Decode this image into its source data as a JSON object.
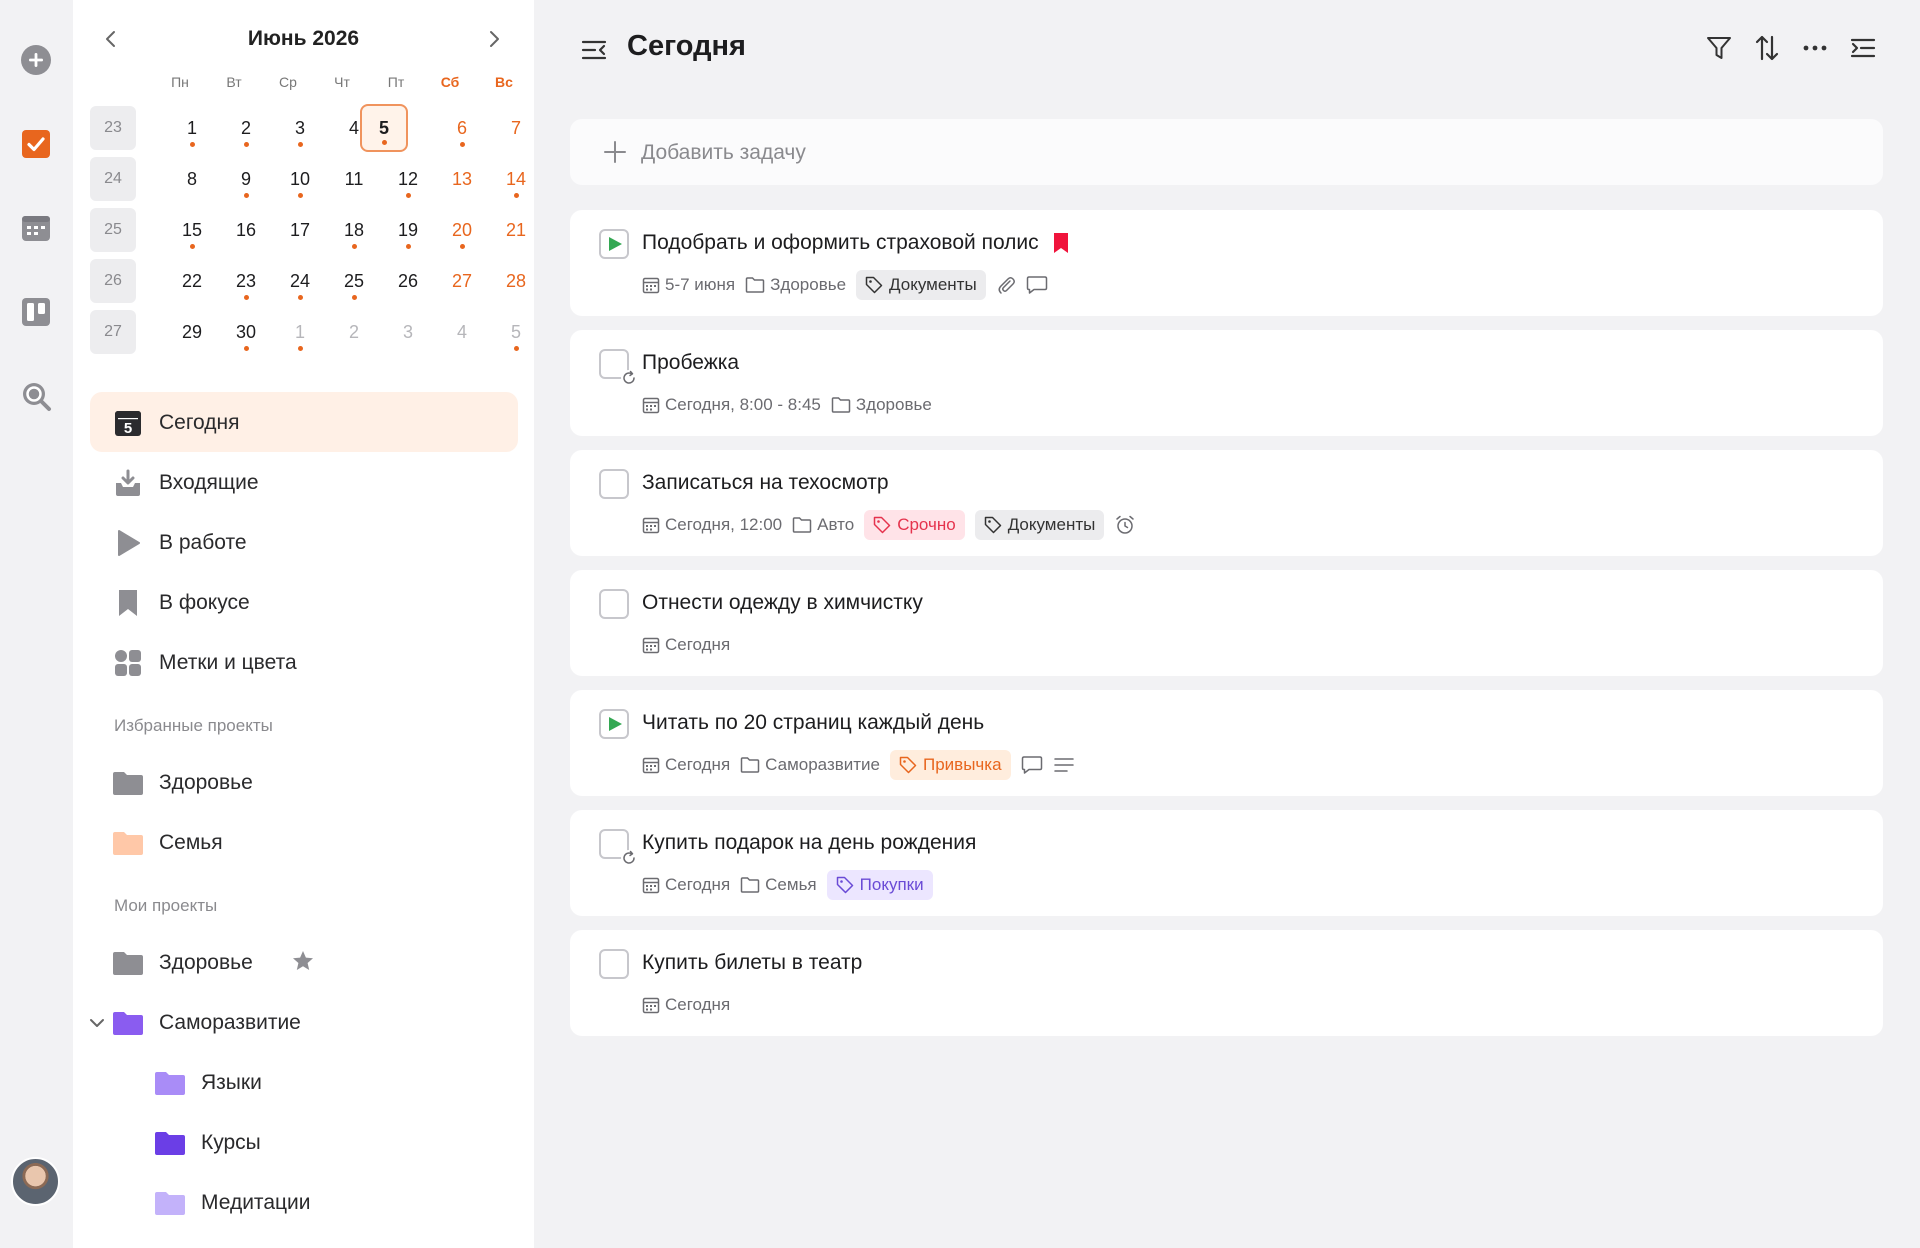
{
  "calendar": {
    "title": "Июнь 2026",
    "weekdays": [
      "Пн",
      "Вт",
      "Ср",
      "Чт",
      "Пт",
      "Сб",
      "Вс"
    ],
    "weeks": [
      {
        "num": "23",
        "days": [
          "1",
          "2",
          "3",
          "4",
          "5",
          "6",
          "7"
        ]
      },
      {
        "num": "24",
        "days": [
          "8",
          "9",
          "10",
          "11",
          "12",
          "13",
          "14"
        ]
      },
      {
        "num": "25",
        "days": [
          "15",
          "16",
          "17",
          "18",
          "19",
          "20",
          "21"
        ]
      },
      {
        "num": "26",
        "days": [
          "22",
          "23",
          "24",
          "25",
          "26",
          "27",
          "28"
        ]
      },
      {
        "num": "27",
        "days": [
          "29",
          "30",
          "1",
          "2",
          "3",
          "4",
          "5"
        ]
      }
    ]
  },
  "nav": {
    "today": {
      "label": "Сегодня",
      "badge": "5"
    },
    "inbox": {
      "label": "Входящие"
    },
    "in_progress": {
      "label": "В работе"
    },
    "focus": {
      "label": "В фокусе"
    },
    "tags": {
      "label": "Метки и цвета"
    }
  },
  "favorites": {
    "title": "Избранные проекты",
    "items": [
      {
        "label": "Здоровье",
        "color": "#8e8e93"
      },
      {
        "label": "Семья",
        "color": "#ffc8a8"
      }
    ]
  },
  "projects": {
    "title": "Мои проекты",
    "items": [
      {
        "label": "Здоровье",
        "color": "#8e8e93"
      },
      {
        "label": "Саморазвитие",
        "color": "#8a5cf0"
      },
      {
        "label": "Языки",
        "color": "#a98cf7"
      },
      {
        "label": "Курсы",
        "color": "#6b3ee6"
      },
      {
        "label": "Медитации",
        "color": "#c3b2fa"
      }
    ]
  },
  "main": {
    "title": "Сегодня",
    "add_placeholder": "Добавить задачу"
  },
  "tasks": [
    {
      "title": "Подобрать и оформить страховой полис",
      "date": "5-7 июня",
      "project": "Здоровье",
      "tags": [
        {
          "label": "Документы",
          "style": "grey"
        }
      ]
    },
    {
      "title": "Пробежка",
      "date": "Сегодня, 8:00 - 8:45",
      "project": "Здоровье",
      "tags": []
    },
    {
      "title": "Записаться на техосмотр",
      "date": "Сегодня, 12:00",
      "project": "Авто",
      "tags": [
        {
          "label": "Срочно",
          "style": "red"
        },
        {
          "label": "Документы",
          "style": "grey"
        }
      ]
    },
    {
      "title": "Отнести одежду в химчистку",
      "date": "Сегодня",
      "tags": []
    },
    {
      "title": "Читать по 20 страниц каждый день",
      "date": "Сегодня",
      "project": "Саморазвитие",
      "tags": [
        {
          "label": "Привычка",
          "style": "orange"
        }
      ]
    },
    {
      "title": "Купить подарок на день рождения",
      "date": "Сегодня",
      "project": "Семья",
      "tags": [
        {
          "label": "Покупки",
          "style": "purple"
        }
      ]
    },
    {
      "title": "Купить билеты в театр",
      "date": "Сегодня",
      "tags": []
    }
  ],
  "colors": {
    "accent": "#e8661e",
    "play": "#34a853",
    "flag": "#f0143c"
  }
}
